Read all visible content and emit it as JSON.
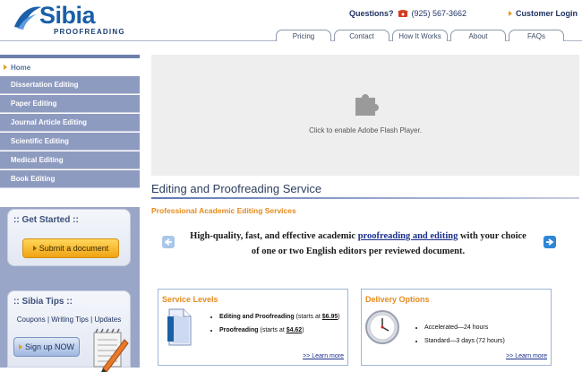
{
  "brand": {
    "name": "Sibia",
    "sub": "PROOFREADING"
  },
  "header": {
    "questions_label": "Questions?",
    "phone": "(925) 567-3662",
    "login_label": "Customer Login"
  },
  "nav": {
    "tabs": [
      "Pricing",
      "Contact",
      "How It Works",
      "About",
      "FAQs"
    ]
  },
  "sidebar": {
    "home": "Home",
    "items": [
      "Dissertation Editing",
      "Paper Editing",
      "Journal Article Editing",
      "Scientific Editing",
      "Medical Editing",
      "Book Editing"
    ],
    "get_started": {
      "title": ":: Get Started ::",
      "button": "Submit a document"
    },
    "tips": {
      "title": ":: Sibia Tips ::",
      "links": "Coupons | Writing Tips | Updates",
      "button": "Sign up NOW"
    }
  },
  "flash": {
    "text": "Click to enable Adobe Flash Player."
  },
  "main": {
    "title": "Editing and Proofreading Service",
    "subtitle": "Professional Academic Editing Services",
    "intro_before": "High-quality, fast, and effective academic ",
    "intro_link": "proofreading and editing",
    "intro_after": " with your choice of one or two English editors per reviewed document."
  },
  "service_levels": {
    "title": "Service Levels",
    "item1_name": "Editing and Proofreading",
    "item1_pre": " (starts at ",
    "item1_price": "$6.95",
    "item1_post": ")",
    "item2_name": "Proofreading",
    "item2_pre": " (starts at ",
    "item2_price": "$4.62",
    "item2_post": ")",
    "learn_more": ">> Learn more"
  },
  "delivery": {
    "title": "Delivery Options",
    "item1": "Accelerated—24 hours",
    "item2": "Standard—3 days (72 hours)",
    "learn_more": ">> Learn more"
  },
  "colors": {
    "brand_blue": "#1a5fa8",
    "accent_orange": "#e58b1d",
    "sidebar_blue": "#8e9bc0"
  }
}
